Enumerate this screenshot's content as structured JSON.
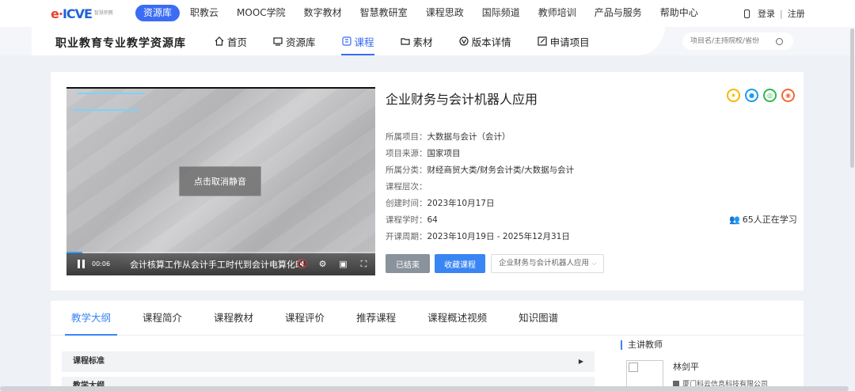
{
  "logo": {
    "mark": "e·icve",
    "sub": "智慧职教"
  },
  "topnav": [
    {
      "label": "资源库",
      "active": true
    },
    {
      "label": "职教云"
    },
    {
      "label": "MOOC学院"
    },
    {
      "label": "数字教材"
    },
    {
      "label": "智慧教研室"
    },
    {
      "label": "课程思政"
    },
    {
      "label": "国际频道"
    },
    {
      "label": "教师培训"
    },
    {
      "label": "产品与服务"
    },
    {
      "label": "帮助中心"
    }
  ],
  "auth": {
    "login": "登录",
    "sep": "|",
    "register": "注册"
  },
  "site_title": "职业教育专业教学资源库",
  "subnav": [
    {
      "label": "首页",
      "icon": "home-icon"
    },
    {
      "label": "资源库",
      "icon": "library-icon"
    },
    {
      "label": "课程",
      "icon": "course-icon",
      "active": true
    },
    {
      "label": "素材",
      "icon": "folder-icon"
    },
    {
      "label": "版本详情",
      "icon": "version-icon"
    },
    {
      "label": "申请项目",
      "icon": "edit-icon"
    }
  ],
  "search": {
    "placeholder": "项目名/主持院校/省份"
  },
  "video": {
    "unmute_label": "点击取消静音",
    "time": "00:06",
    "subtitle": "会计核算工作从会计手工时代到会计电算化时代",
    "progress_percent": 5
  },
  "course": {
    "title": "企业财务与会计机器人应用",
    "meta": [
      {
        "key": "所属项目：",
        "value": "大数据与会计（会计）"
      },
      {
        "key": "项目来源：",
        "value": "国家项目"
      },
      {
        "key": "所属分类：",
        "value": "财经商贸大类/财务会计类/大数据与会计"
      },
      {
        "key": "课程层次：",
        "value": ""
      },
      {
        "key": "创建时间：",
        "value": "2023年10月17日"
      },
      {
        "key": "课程学时：",
        "value": "64"
      },
      {
        "key": "开课周期：",
        "value": "2023年10月19日 - 2025年12月31日"
      }
    ],
    "learners": "65人正在学习",
    "btn_done": "已结束",
    "btn_fav": "收藏课程",
    "version_select": "企业财务与会计机器人应用"
  },
  "share_colors": [
    "#f5b800",
    "#1e9bf0",
    "#2fb94e",
    "#f06a3a"
  ],
  "tabs": [
    {
      "label": "教学大纲",
      "active": true
    },
    {
      "label": "课程简介"
    },
    {
      "label": "课程教材"
    },
    {
      "label": "课程评价"
    },
    {
      "label": "推荐课程"
    },
    {
      "label": "课程概述视频"
    },
    {
      "label": "知识图谱"
    }
  ],
  "outline": {
    "item1": "课程标准",
    "item2": "教学大纲"
  },
  "teacher": {
    "section": "主讲教师",
    "name": "林剑平",
    "org": "厦门科云信息科技有限公司"
  }
}
